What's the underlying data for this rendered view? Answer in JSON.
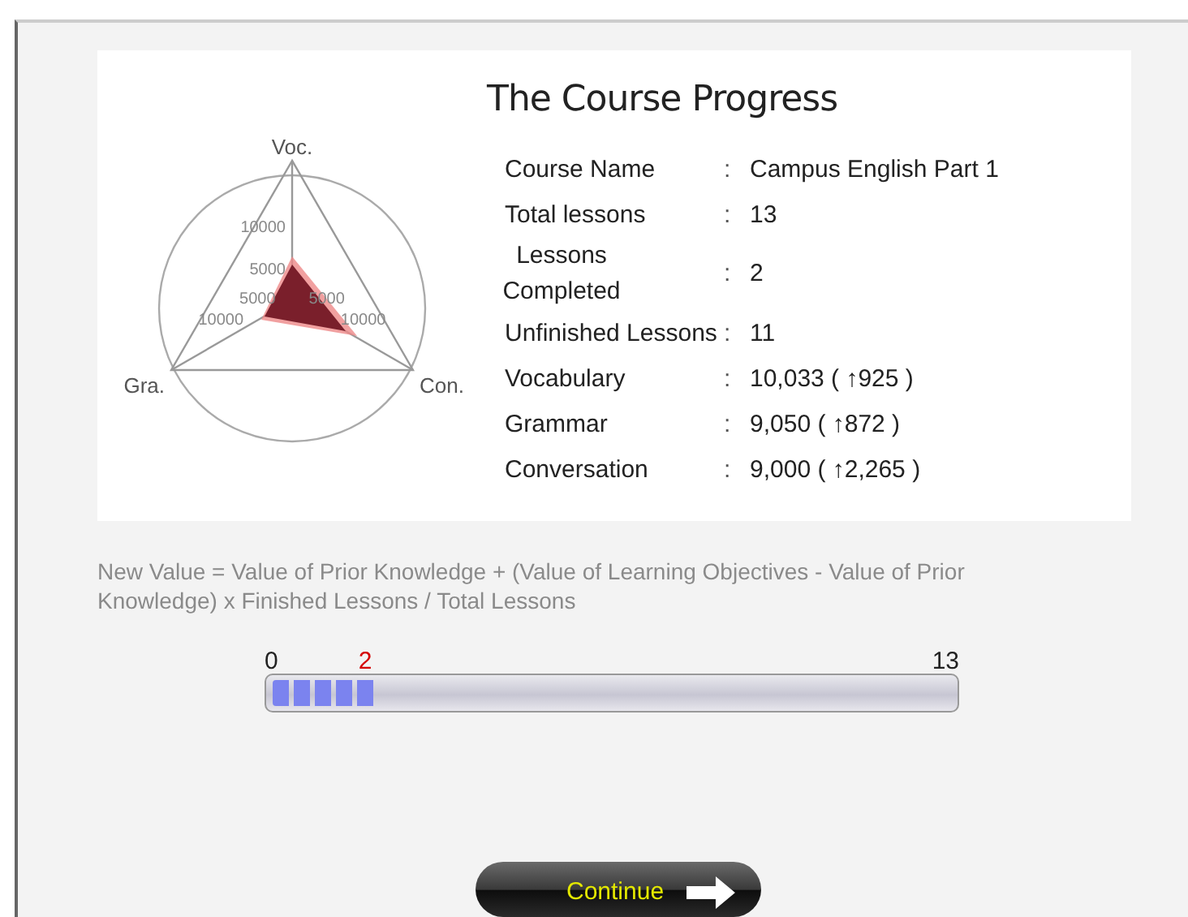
{
  "title": "The Course Progress",
  "radar": {
    "axes": [
      {
        "label": "Voc.",
        "ticks": [
          "10000",
          "5000"
        ]
      },
      {
        "label": "Gra.",
        "ticks": [
          "5000",
          "10000"
        ]
      },
      {
        "label": "Con.",
        "ticks": [
          "5000",
          "10000"
        ]
      }
    ]
  },
  "details": [
    {
      "label": "Course Name",
      "value": "Campus English Part 1",
      "wrapped": false
    },
    {
      "label": "Total lessons",
      "value": "13",
      "wrapped": false
    },
    {
      "label": "Lessons Completed",
      "value": "2",
      "wrapped": true
    },
    {
      "label": "Unfinished Lessons",
      "value": "11",
      "wrapped": false
    },
    {
      "label": "Vocabulary",
      "value": "10,033 ( ↑925 )",
      "wrapped": false
    },
    {
      "label": "Grammar",
      "value": "9,050 ( ↑872 )",
      "wrapped": false
    },
    {
      "label": "Conversation",
      "value": "9,000 ( ↑2,265 )",
      "wrapped": false
    }
  ],
  "separator": ":",
  "formula": "New Value = Value of Prior Knowledge + (Value of Learning Objectives - Value of Prior Knowledge) x Finished Lessons / Total Lessons",
  "progress": {
    "min_label": "0",
    "current_label": "2",
    "max_label": "13",
    "level": 0.154
  },
  "continue_button": "Continue"
}
